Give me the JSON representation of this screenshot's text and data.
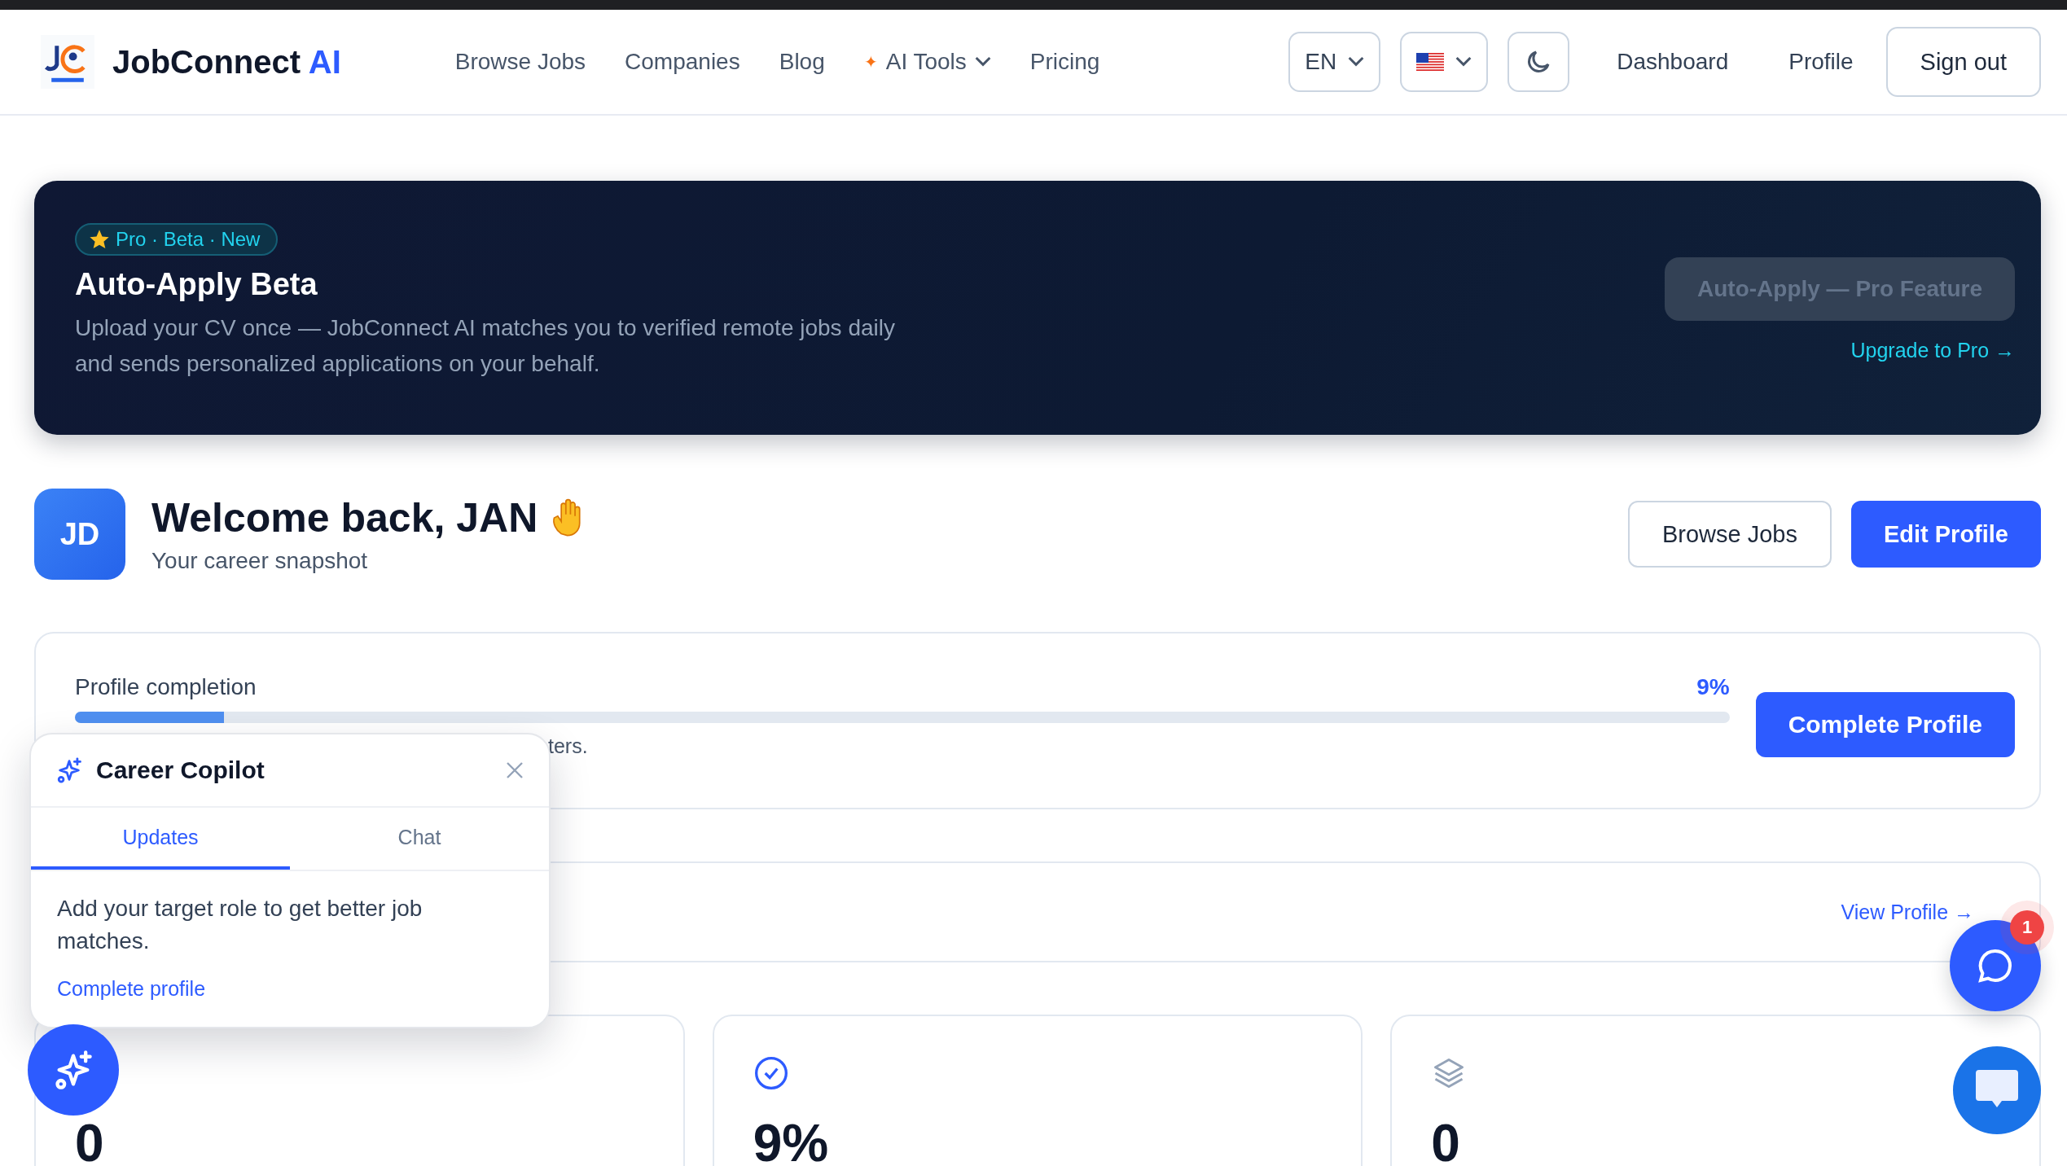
{
  "header": {
    "brand": "JobConnect",
    "brand_accent": "AI",
    "nav": [
      {
        "label": "Browse Jobs",
        "kind": "link"
      },
      {
        "label": "Companies",
        "kind": "link"
      },
      {
        "label": "Blog",
        "kind": "link"
      },
      {
        "label": "AI Tools",
        "kind": "menu",
        "icon": "✦"
      },
      {
        "label": "Pricing",
        "kind": "link"
      }
    ],
    "language": "EN",
    "actions": [
      "Dashboard",
      "Profile"
    ],
    "sign_out": "Sign out"
  },
  "banner": {
    "badge": "Pro · Beta · New",
    "title": "Auto-Apply Beta",
    "description": "Upload your CV once — JobConnect AI matches you to verified remote jobs daily and sends personalized applications on your behalf.",
    "button": {
      "label": "Auto-Apply — Pro Feature",
      "disabled": true
    },
    "link": "Upgrade to Pro →"
  },
  "welcome": {
    "initials": "JD",
    "heading": "Welcome back, JAN",
    "subtitle": "Your career snapshot",
    "buttons": [
      {
        "label": "Browse Jobs",
        "kind": "secondary"
      },
      {
        "label": "Edit Profile",
        "kind": "primary"
      }
    ]
  },
  "profile_completion": {
    "label": "Profile completion",
    "percent": "9%",
    "level": 0.09,
    "hint": "ters.",
    "button": "Complete Profile"
  },
  "profile_card": {
    "link": "View Profile →"
  },
  "stats": [
    {
      "kind": "hidden",
      "value": "0"
    },
    {
      "kind": "check",
      "value": "9%"
    },
    {
      "kind": "layers",
      "value": "0"
    }
  ],
  "copilot": {
    "title": "Career Copilot",
    "tabs": [
      {
        "label": "Updates",
        "selected": true
      },
      {
        "label": "Chat",
        "selected": false
      }
    ],
    "message": "Add your target role to get better job matches.",
    "link": "Complete profile"
  },
  "chat_badge": "1"
}
